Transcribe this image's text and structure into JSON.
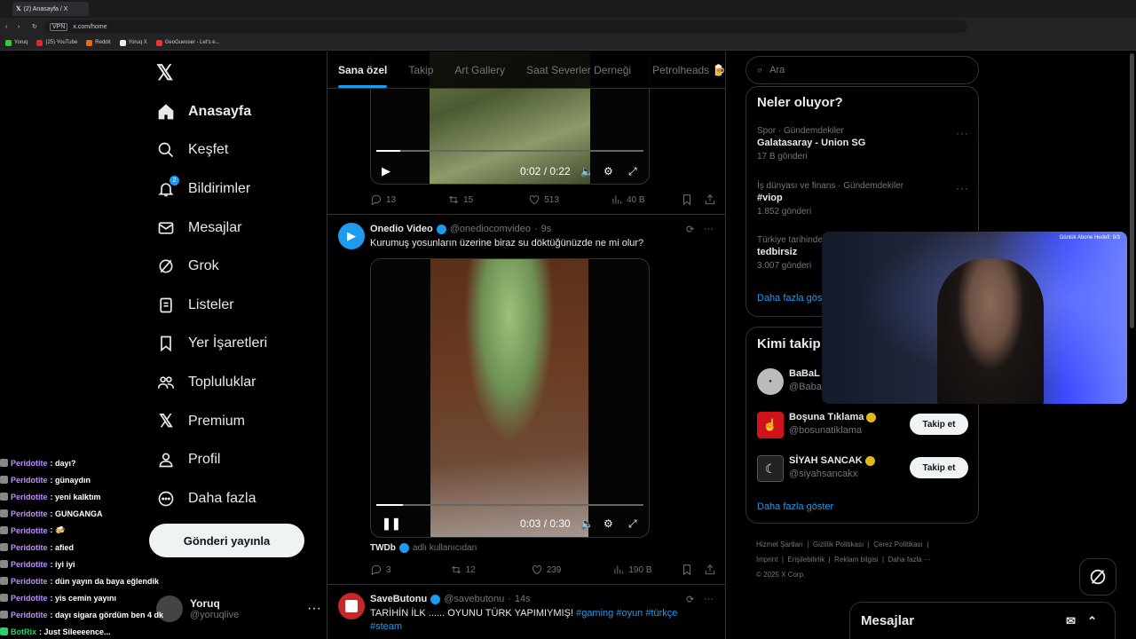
{
  "browser": {
    "tab_title": "(2) Anasayfa / X",
    "url": "x.com/home",
    "vpn_label": "VPN",
    "bookmarks": [
      "Yoruq",
      "(25) YouTube",
      "Reddit",
      "Yoruq X",
      "GeoGuesser - Let's e..."
    ]
  },
  "nav": {
    "items": [
      {
        "label": "Anasayfa",
        "icon": "home-icon"
      },
      {
        "label": "Keşfet",
        "icon": "search-icon"
      },
      {
        "label": "Bildirimler",
        "icon": "bell-icon",
        "badge": "2"
      },
      {
        "label": "Mesajlar",
        "icon": "mail-icon"
      },
      {
        "label": "Grok",
        "icon": "grok-icon"
      },
      {
        "label": "Listeler",
        "icon": "list-icon"
      },
      {
        "label": "Yer İşaretleri",
        "icon": "bookmark-icon"
      },
      {
        "label": "Topluluklar",
        "icon": "people-icon"
      },
      {
        "label": "Premium",
        "icon": "x-icon"
      },
      {
        "label": "Profil",
        "icon": "person-icon"
      },
      {
        "label": "Daha fazla",
        "icon": "more-circle-icon"
      }
    ],
    "post_button": "Gönderi yayınla",
    "user_name": "Yoruq",
    "user_handle": "@yoruqlive"
  },
  "chat": [
    {
      "user": "Peridotite",
      "msg": ": dayı?"
    },
    {
      "user": "Peridotite",
      "msg": ": günaydın"
    },
    {
      "user": "Peridotite",
      "msg": ": yeni kalktım"
    },
    {
      "user": "Peridotite",
      "msg": ": GUNGANGA"
    },
    {
      "user": "Peridotite",
      "msg": ": 🍻"
    },
    {
      "user": "Peridotite",
      "msg": ": afied"
    },
    {
      "user": "Peridotite",
      "msg": ": iyi iyi"
    },
    {
      "user": "Peridotite",
      "msg": ": dün yayın da baya eğlendik"
    },
    {
      "user": "Peridotite",
      "msg": ": yis cemin yayını"
    },
    {
      "user": "Peridotite",
      "msg": ": dayı sigara gördüm ben 4 dk"
    },
    {
      "user": "BotRix",
      "msg": ": Just Sileeeence..."
    }
  ],
  "feed": {
    "tabs": [
      "Sana özel",
      "Takip",
      "Art Gallery",
      "Saat Severler Derneği",
      "Petrolheads 🍺"
    ],
    "post1": {
      "time": "0:02 / 0:22",
      "progress": 0.09,
      "replies": "13",
      "reposts": "15",
      "likes": "513",
      "views": "40 B"
    },
    "post2": {
      "name": "Onedio Video",
      "handle": "@onediocomvideo",
      "age": "9s",
      "text": "Kurumuş yosunların üzerine biraz su döktüğünüzde ne mi olur?",
      "time": "0:03 / 0:30",
      "progress": 0.1,
      "credit_name": "TWDb",
      "credit_text": "adlı kullanıcıdan",
      "replies": "3",
      "reposts": "12",
      "likes": "239",
      "views": "190 B"
    },
    "post3": {
      "name": "SaveButonu",
      "handle": "@savebutonu",
      "age": "14s",
      "text": "TARİHİN İLK ...... OYUNU TÜRK YAPIMIYMIŞ!",
      "hashtags": "#gaming #oyun #türkçe",
      "hashtag2": "#steam"
    }
  },
  "sidebar": {
    "search_placeholder": "Ara",
    "trends_title": "Neler oluyor?",
    "trends": [
      {
        "meta": "Spor · Gündemdekiler",
        "name": "Galatasaray - Union SG",
        "count": "17 B gönderi"
      },
      {
        "meta": "İş dünyası ve finans · Gündemdekiler",
        "name": "#viop",
        "count": "1.852 gönderi"
      },
      {
        "meta": "Türkiye tarihinde",
        "name": "tedbirsiz",
        "count": "3.007 gönderi"
      }
    ],
    "trends_more": "Daha fazla göster",
    "who_title": "Kimi takip",
    "who": [
      {
        "name": "BaBaL",
        "handle": "@Baba"
      },
      {
        "name": "Boşuna Tıklama",
        "handle": "@bosunatiklama",
        "button": "Takip et"
      },
      {
        "name": "SİYAH SANCAK",
        "handle": "@siyahsancakx",
        "button": "Takip et"
      }
    ],
    "who_more": "Daha fazla göster",
    "footer": [
      "Hizmet Şartları",
      "Gizlilik Politikası",
      "Çerez Politikası",
      "Imprint",
      "Erişilebilirlik",
      "Reklam bilgisi",
      "Daha fazla ···",
      "© 2025 X Corp."
    ]
  },
  "webcam": {
    "overlay_text": "Günlük Abone Hedefi: 9/3"
  },
  "messages": {
    "title": "Mesajlar"
  },
  "colors": {
    "accent": "#1d9bf0",
    "background": "#000000",
    "gold": "#e2b719",
    "chat_user": "#c08cff"
  }
}
